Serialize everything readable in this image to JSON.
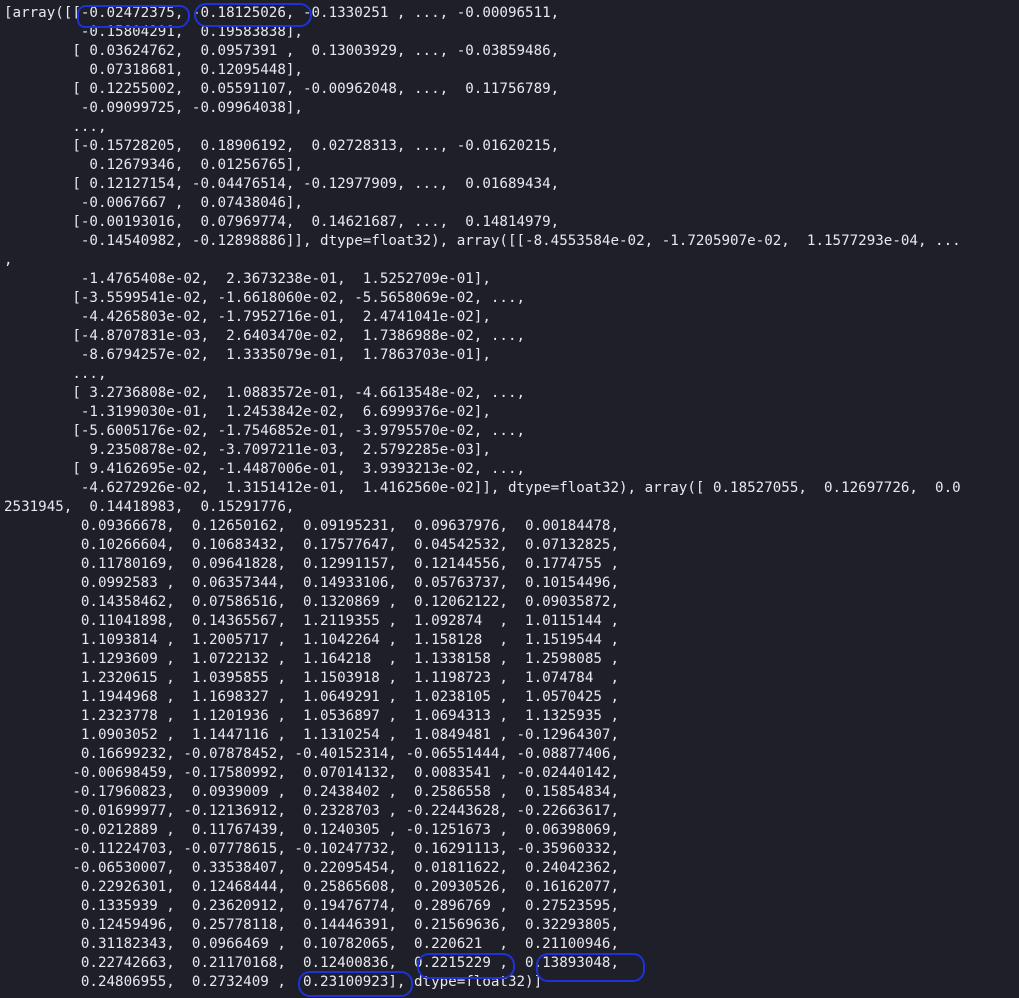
{
  "terminal": {
    "lines": [
      "[array([[-0.02472375, -0.18125026, -0.1330251 , ..., -0.00096511,",
      "         -0.15804291,  0.19583838],",
      "        [ 0.03624762,  0.0957391 ,  0.13003929, ..., -0.03859486,",
      "          0.07318681,  0.12095448],",
      "        [ 0.12255002,  0.05591107, -0.00962048, ...,  0.11756789,",
      "         -0.09099725, -0.09964038],",
      "        ...,",
      "        [-0.15728205,  0.18906192,  0.02728313, ..., -0.01620215,",
      "          0.12679346,  0.01256765],",
      "        [ 0.12127154, -0.04476514, -0.12977909, ...,  0.01689434,",
      "         -0.0067667 ,  0.07438046],",
      "        [-0.00193016,  0.07969774,  0.14621687, ...,  0.14814979,",
      "         -0.14540982, -0.12898886]], dtype=float32), array([[-8.4553584e-02, -1.7205907e-02,  1.1577293e-04, ...",
      ",",
      "         -1.4765408e-02,  2.3673238e-01,  1.5252709e-01],",
      "        [-3.5599541e-02, -1.6618060e-02, -5.5658069e-02, ...,",
      "         -4.4265803e-02, -1.7952716e-01,  2.4741041e-02],",
      "        [-4.8707831e-03,  2.6403470e-02,  1.7386988e-02, ...,",
      "         -8.6794257e-02,  1.3335079e-01,  1.7863703e-01],",
      "        ...,",
      "        [ 3.2736808e-02,  1.0883572e-01, -4.6613548e-02, ...,",
      "         -1.3199030e-01,  1.2453842e-02,  6.6999376e-02],",
      "        [-5.6005176e-02, -1.7546852e-01, -3.9795570e-02, ...,",
      "          9.2350878e-02, -3.7097211e-03,  2.5792285e-03],",
      "        [ 9.4162695e-02, -1.4487006e-01,  3.9393213e-02, ...,",
      "         -4.6272926e-02,  1.3151412e-01,  1.4162560e-02]], dtype=float32), array([ 0.18527055,  0.12697726,  0.0",
      "2531945,  0.14418983,  0.15291776,",
      "         0.09366678,  0.12650162,  0.09195231,  0.09637976,  0.00184478,",
      "         0.10266604,  0.10683432,  0.17577647,  0.04542532,  0.07132825,",
      "         0.11780169,  0.09641828,  0.12991157,  0.12144556,  0.1774755 ,",
      "         0.0992583 ,  0.06357344,  0.14933106,  0.05763737,  0.10154496,",
      "         0.14358462,  0.07586516,  0.1320869 ,  0.12062122,  0.09035872,",
      "         0.11041898,  0.14365567,  1.2119355 ,  1.092874  ,  1.0115144 ,",
      "         1.1093814 ,  1.2005717 ,  1.1042264 ,  1.158128  ,  1.1519544 ,",
      "         1.1293609 ,  1.0722132 ,  1.164218  ,  1.1338158 ,  1.2598085 ,",
      "         1.2320615 ,  1.0395855 ,  1.1503918 ,  1.1198723 ,  1.074784  ,",
      "         1.1944968 ,  1.1698327 ,  1.0649291 ,  1.0238105 ,  1.0570425 ,",
      "         1.2323778 ,  1.1201936 ,  1.0536897 ,  1.0694313 ,  1.1325935 ,",
      "         1.0903052 ,  1.1447116 ,  1.1310254 ,  1.0849481 , -0.12964307,",
      "         0.16699232, -0.07878452, -0.40152314, -0.06551444, -0.08877406,",
      "        -0.00698459, -0.17580992,  0.07014132,  0.0083541 , -0.02440142,",
      "        -0.17960823,  0.0939009 ,  0.2438402 ,  0.2586558 ,  0.15854834,",
      "        -0.01699977, -0.12136912,  0.2328703 , -0.22443628, -0.22663617,",
      "        -0.0212889 ,  0.11767439,  0.1240305 , -0.1251673 ,  0.06398069,",
      "        -0.11224703, -0.07778615, -0.10247732,  0.16291113, -0.35960332,",
      "        -0.06530007,  0.33538407,  0.22095454,  0.01811622,  0.24042362,",
      "         0.22926301,  0.12468444,  0.25865608,  0.20930526,  0.16162077,",
      "         0.1335939 ,  0.23620912,  0.19476774,  0.2896769 ,  0.27523595,",
      "         0.12459496,  0.25778118,  0.14446391,  0.21569636,  0.32293805,",
      "         0.31182343,  0.0966469 ,  0.10782065,  0.220621  ,  0.21100946,",
      "         0.22742663,  0.21170168,  0.12400836,  0.2215229 ,  0.13893048,",
      "         0.24806955,  0.2732409 ,  0.23100923], dtype=float32)]"
    ]
  },
  "annotation_color": "#1d33d6",
  "background_color": "#1e1f29",
  "text_color": "#e8e8ee"
}
